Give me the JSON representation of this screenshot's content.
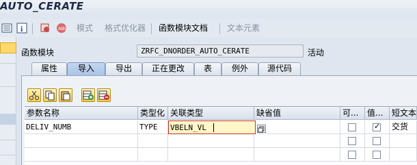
{
  "window": {
    "title": "AUTO_CERATE"
  },
  "toolbar": {
    "items": [
      {
        "label": "模式",
        "enabled": false
      },
      {
        "label": "格式优化器",
        "enabled": false
      },
      {
        "label": "函数模块文档",
        "enabled": true
      },
      {
        "label": "文本元素",
        "enabled": false
      }
    ]
  },
  "header": {
    "function_module_label": "函数模块",
    "function_module_value": "ZRFC_DNORDER_AUTO_CERATE",
    "status": "活动"
  },
  "tabs": [
    {
      "label": "属性",
      "active": false
    },
    {
      "label": "导入",
      "active": true
    },
    {
      "label": "导出",
      "active": false
    },
    {
      "label": "正在更改",
      "active": false
    },
    {
      "label": "表",
      "active": false
    },
    {
      "label": "例外",
      "active": false
    },
    {
      "label": "源代码",
      "active": false
    }
  ],
  "grid": {
    "columns": [
      "参数名称",
      "类型化",
      "关联类型",
      "缺省值",
      "可...",
      "值...",
      "短文本"
    ],
    "rows": [
      {
        "param": "DELIV_NUMB",
        "typing": "TYPE",
        "assoc_type": "VBELN_VL",
        "default": "",
        "optional": false,
        "pass_value": true,
        "short_text": "交货"
      },
      {
        "param": "",
        "typing": "",
        "assoc_type": "",
        "default": "",
        "optional": false,
        "pass_value": false,
        "short_text": ""
      },
      {
        "param": "",
        "typing": "",
        "assoc_type": "",
        "default": "",
        "optional": false,
        "pass_value": false,
        "short_text": ""
      }
    ]
  },
  "colors": {
    "accent": "#ffd86a",
    "active_tab": "#a9c4e6",
    "edit_border": "#c9302c"
  }
}
